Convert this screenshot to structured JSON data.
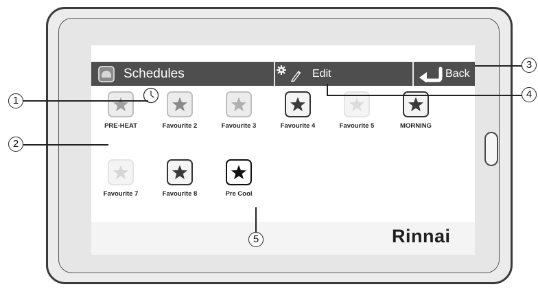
{
  "header": {
    "title": "Schedules",
    "schedules_icon": "folder-icon",
    "edit_icons": [
      "gear-icon",
      "pencil-icon"
    ],
    "edit_label": "Edit",
    "back_icon": "back-arrow-icon",
    "back_label": "Back"
  },
  "favourites": [
    {
      "label": "PRE-HEAT",
      "state": "light",
      "icon": "star-icon"
    },
    {
      "label": "Favourite 2",
      "state": "light",
      "icon": "star-icon"
    },
    {
      "label": "Favourite 3",
      "state": "light",
      "icon": "star-icon"
    },
    {
      "label": "Favourite 4",
      "state": "dark",
      "icon": "star-icon"
    },
    {
      "label": "Favourite 5",
      "state": "faint",
      "icon": "star-icon"
    },
    {
      "label": "MORNING",
      "state": "dark",
      "icon": "star-icon"
    },
    {
      "label": "Favourite 7",
      "state": "faint",
      "icon": "star-icon"
    },
    {
      "label": "Favourite 8",
      "state": "dark",
      "icon": "star-icon"
    },
    {
      "label": "Pre Cool",
      "state": "black",
      "icon": "star-icon"
    }
  ],
  "badge_icon": "clock-icon",
  "footer": {
    "logo": "Rinnai"
  },
  "callouts": [
    "1",
    "2",
    "3",
    "4",
    "5"
  ],
  "colors": {
    "header_bg": "#4e4e4e",
    "star_light": "#999999",
    "star_faint": "#d6d6d6",
    "star_dark": "#3a3a3a",
    "star_black": "#111111"
  }
}
